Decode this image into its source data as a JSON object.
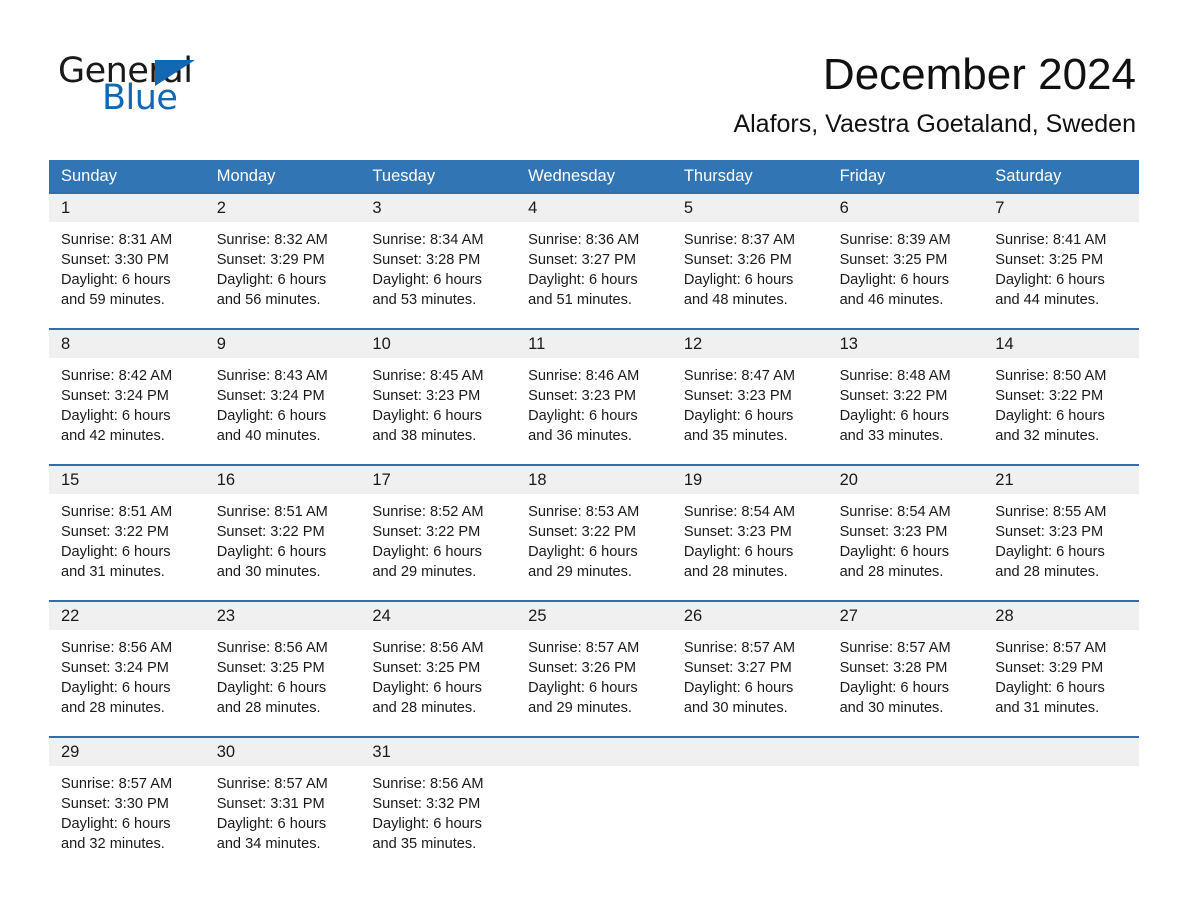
{
  "brand": {
    "name_top": "General",
    "name_bottom": "Blue",
    "triangle_color": "#1268b3",
    "top_color": "#1a1a1a"
  },
  "header": {
    "title": "December 2024",
    "location": "Alafors, Vaestra Goetaland, Sweden"
  },
  "theme": {
    "header_blue": "#3275b4",
    "week_rule": "#2f6fae",
    "daynum_band": "#f0f0f0",
    "text": "#1a1a1a"
  },
  "calendar": {
    "day_headers": [
      "Sunday",
      "Monday",
      "Tuesday",
      "Wednesday",
      "Thursday",
      "Friday",
      "Saturday"
    ],
    "weeks": [
      [
        {
          "day": "1",
          "lines": [
            "Sunrise: 8:31 AM",
            "Sunset: 3:30 PM",
            "Daylight: 6 hours",
            "and 59 minutes."
          ]
        },
        {
          "day": "2",
          "lines": [
            "Sunrise: 8:32 AM",
            "Sunset: 3:29 PM",
            "Daylight: 6 hours",
            "and 56 minutes."
          ]
        },
        {
          "day": "3",
          "lines": [
            "Sunrise: 8:34 AM",
            "Sunset: 3:28 PM",
            "Daylight: 6 hours",
            "and 53 minutes."
          ]
        },
        {
          "day": "4",
          "lines": [
            "Sunrise: 8:36 AM",
            "Sunset: 3:27 PM",
            "Daylight: 6 hours",
            "and 51 minutes."
          ]
        },
        {
          "day": "5",
          "lines": [
            "Sunrise: 8:37 AM",
            "Sunset: 3:26 PM",
            "Daylight: 6 hours",
            "and 48 minutes."
          ]
        },
        {
          "day": "6",
          "lines": [
            "Sunrise: 8:39 AM",
            "Sunset: 3:25 PM",
            "Daylight: 6 hours",
            "and 46 minutes."
          ]
        },
        {
          "day": "7",
          "lines": [
            "Sunrise: 8:41 AM",
            "Sunset: 3:25 PM",
            "Daylight: 6 hours",
            "and 44 minutes."
          ]
        }
      ],
      [
        {
          "day": "8",
          "lines": [
            "Sunrise: 8:42 AM",
            "Sunset: 3:24 PM",
            "Daylight: 6 hours",
            "and 42 minutes."
          ]
        },
        {
          "day": "9",
          "lines": [
            "Sunrise: 8:43 AM",
            "Sunset: 3:24 PM",
            "Daylight: 6 hours",
            "and 40 minutes."
          ]
        },
        {
          "day": "10",
          "lines": [
            "Sunrise: 8:45 AM",
            "Sunset: 3:23 PM",
            "Daylight: 6 hours",
            "and 38 minutes."
          ]
        },
        {
          "day": "11",
          "lines": [
            "Sunrise: 8:46 AM",
            "Sunset: 3:23 PM",
            "Daylight: 6 hours",
            "and 36 minutes."
          ]
        },
        {
          "day": "12",
          "lines": [
            "Sunrise: 8:47 AM",
            "Sunset: 3:23 PM",
            "Daylight: 6 hours",
            "and 35 minutes."
          ]
        },
        {
          "day": "13",
          "lines": [
            "Sunrise: 8:48 AM",
            "Sunset: 3:22 PM",
            "Daylight: 6 hours",
            "and 33 minutes."
          ]
        },
        {
          "day": "14",
          "lines": [
            "Sunrise: 8:50 AM",
            "Sunset: 3:22 PM",
            "Daylight: 6 hours",
            "and 32 minutes."
          ]
        }
      ],
      [
        {
          "day": "15",
          "lines": [
            "Sunrise: 8:51 AM",
            "Sunset: 3:22 PM",
            "Daylight: 6 hours",
            "and 31 minutes."
          ]
        },
        {
          "day": "16",
          "lines": [
            "Sunrise: 8:51 AM",
            "Sunset: 3:22 PM",
            "Daylight: 6 hours",
            "and 30 minutes."
          ]
        },
        {
          "day": "17",
          "lines": [
            "Sunrise: 8:52 AM",
            "Sunset: 3:22 PM",
            "Daylight: 6 hours",
            "and 29 minutes."
          ]
        },
        {
          "day": "18",
          "lines": [
            "Sunrise: 8:53 AM",
            "Sunset: 3:22 PM",
            "Daylight: 6 hours",
            "and 29 minutes."
          ]
        },
        {
          "day": "19",
          "lines": [
            "Sunrise: 8:54 AM",
            "Sunset: 3:23 PM",
            "Daylight: 6 hours",
            "and 28 minutes."
          ]
        },
        {
          "day": "20",
          "lines": [
            "Sunrise: 8:54 AM",
            "Sunset: 3:23 PM",
            "Daylight: 6 hours",
            "and 28 minutes."
          ]
        },
        {
          "day": "21",
          "lines": [
            "Sunrise: 8:55 AM",
            "Sunset: 3:23 PM",
            "Daylight: 6 hours",
            "and 28 minutes."
          ]
        }
      ],
      [
        {
          "day": "22",
          "lines": [
            "Sunrise: 8:56 AM",
            "Sunset: 3:24 PM",
            "Daylight: 6 hours",
            "and 28 minutes."
          ]
        },
        {
          "day": "23",
          "lines": [
            "Sunrise: 8:56 AM",
            "Sunset: 3:25 PM",
            "Daylight: 6 hours",
            "and 28 minutes."
          ]
        },
        {
          "day": "24",
          "lines": [
            "Sunrise: 8:56 AM",
            "Sunset: 3:25 PM",
            "Daylight: 6 hours",
            "and 28 minutes."
          ]
        },
        {
          "day": "25",
          "lines": [
            "Sunrise: 8:57 AM",
            "Sunset: 3:26 PM",
            "Daylight: 6 hours",
            "and 29 minutes."
          ]
        },
        {
          "day": "26",
          "lines": [
            "Sunrise: 8:57 AM",
            "Sunset: 3:27 PM",
            "Daylight: 6 hours",
            "and 30 minutes."
          ]
        },
        {
          "day": "27",
          "lines": [
            "Sunrise: 8:57 AM",
            "Sunset: 3:28 PM",
            "Daylight: 6 hours",
            "and 30 minutes."
          ]
        },
        {
          "day": "28",
          "lines": [
            "Sunrise: 8:57 AM",
            "Sunset: 3:29 PM",
            "Daylight: 6 hours",
            "and 31 minutes."
          ]
        }
      ],
      [
        {
          "day": "29",
          "lines": [
            "Sunrise: 8:57 AM",
            "Sunset: 3:30 PM",
            "Daylight: 6 hours",
            "and 32 minutes."
          ]
        },
        {
          "day": "30",
          "lines": [
            "Sunrise: 8:57 AM",
            "Sunset: 3:31 PM",
            "Daylight: 6 hours",
            "and 34 minutes."
          ]
        },
        {
          "day": "31",
          "lines": [
            "Sunrise: 8:56 AM",
            "Sunset: 3:32 PM",
            "Daylight: 6 hours",
            "and 35 minutes."
          ]
        },
        {
          "day": "",
          "lines": []
        },
        {
          "day": "",
          "lines": []
        },
        {
          "day": "",
          "lines": []
        },
        {
          "day": "",
          "lines": []
        }
      ]
    ]
  }
}
